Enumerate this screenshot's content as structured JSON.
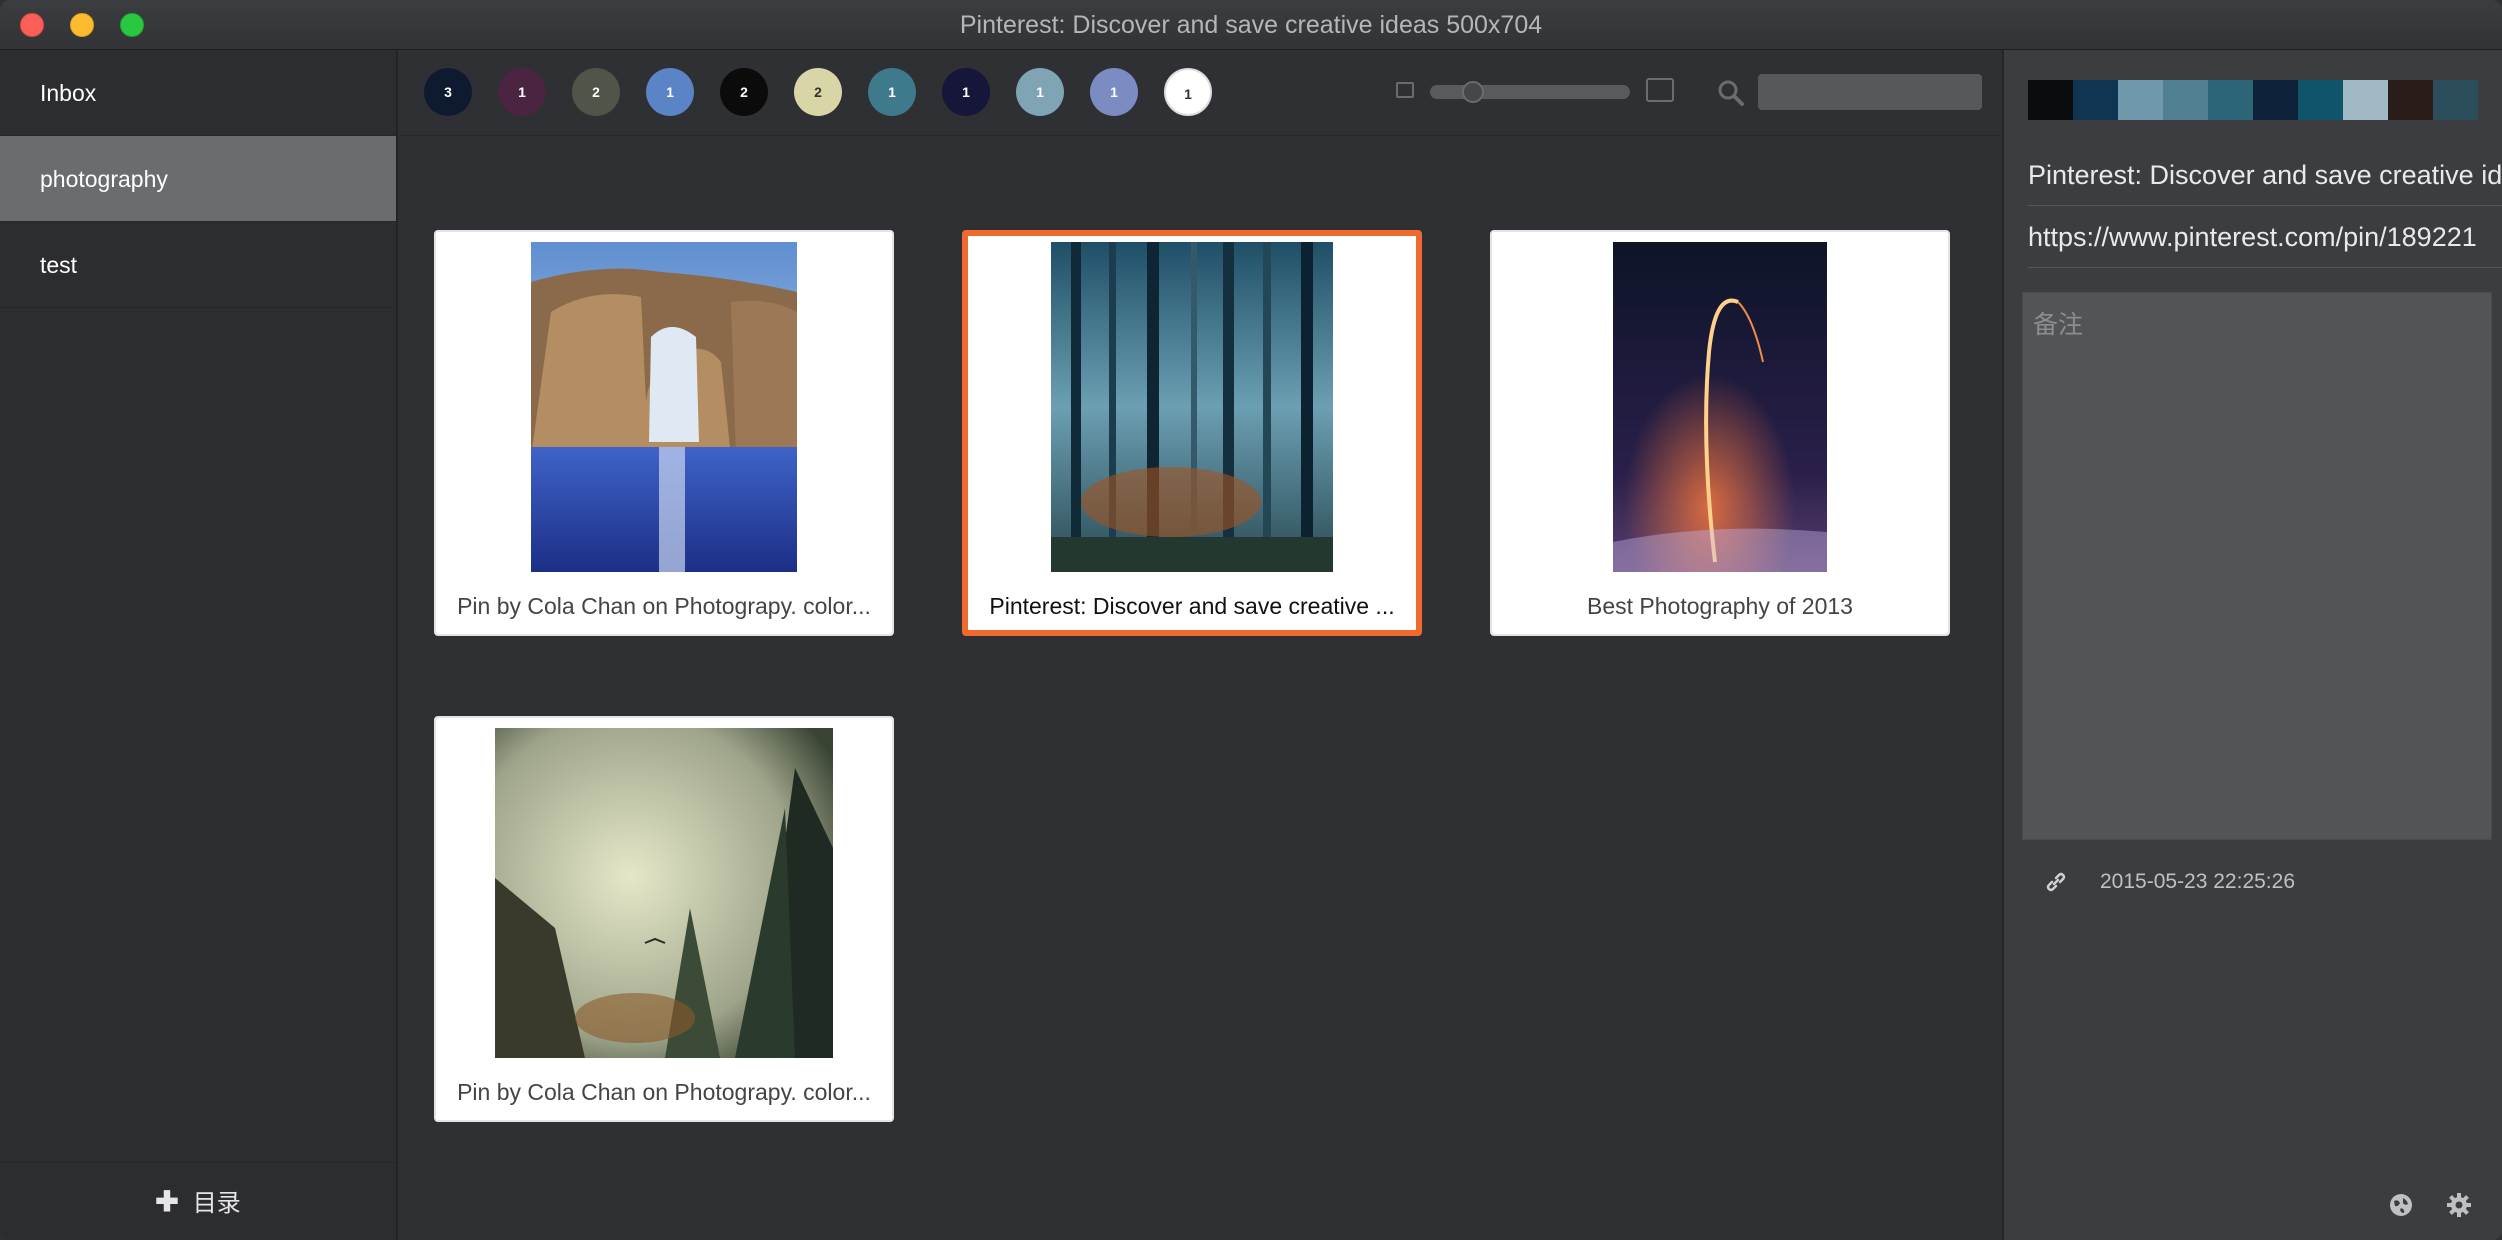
{
  "window": {
    "title": "Pinterest: Discover and save creative ideas 500x704"
  },
  "sidebar": {
    "items": [
      {
        "label": "Inbox",
        "active": false
      },
      {
        "label": "photography",
        "active": true
      },
      {
        "label": "test",
        "active": false
      }
    ],
    "footer_icon": "plus-icon",
    "footer_label": "目录"
  },
  "toolbar": {
    "color_filters": [
      {
        "color": "#0e1a30",
        "count": "3"
      },
      {
        "color": "#4a2440",
        "count": "1"
      },
      {
        "color": "#4f5548",
        "count": "2"
      },
      {
        "color": "#5b84c6",
        "count": "1"
      },
      {
        "color": "#0b0b0c",
        "count": "2"
      },
      {
        "color": "#d8d6a6",
        "count": "2"
      },
      {
        "color": "#3e7a8c",
        "count": "1"
      },
      {
        "color": "#15163a",
        "count": "1"
      },
      {
        "color": "#7fa5b4",
        "count": "1"
      },
      {
        "color": "#7a8cc2",
        "count": "1"
      },
      {
        "color": "#ffffff",
        "count": "1"
      }
    ],
    "zoom_level": 0.2,
    "search_placeholder": ""
  },
  "cards": [
    {
      "caption": "Pin by Cola Chan on Photograpy. color...",
      "selected": false,
      "image": "rock-arch-sea-photo"
    },
    {
      "caption": "Pinterest: Discover and save creative ...",
      "selected": true,
      "image": "misty-forest-photo"
    },
    {
      "caption": "Best Photography of 2013",
      "selected": false,
      "image": "rocket-launch-trail-photo"
    },
    {
      "caption": "Pin by Cola Chan on Photograpy. color...",
      "selected": false,
      "image": "foggy-pine-forest-photo"
    }
  ],
  "detail": {
    "palette": [
      "#0a0c10",
      "#0f3552",
      "#6f98aa",
      "#4f7f91",
      "#2c6478",
      "#0d2139",
      "#10546c",
      "#a1b9c5",
      "#2a1c18",
      "#2b4d5c"
    ],
    "title": "Pinterest: Discover and save creative ideas",
    "url": "https://www.pinterest.com/pin/189221",
    "notes_placeholder": "备注",
    "timestamp": "2015-05-23 22:25:26"
  }
}
